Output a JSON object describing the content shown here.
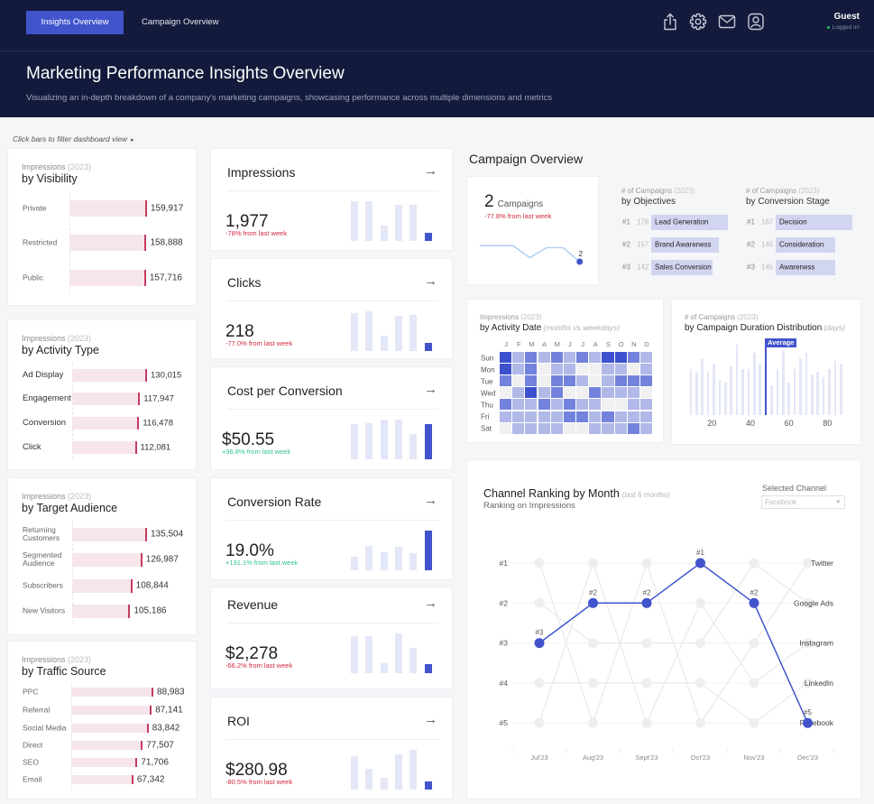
{
  "nav": {
    "tabs": [
      {
        "label": "Insights Overview",
        "active": true
      },
      {
        "label": "Campaign Overview",
        "active": false
      }
    ],
    "actions": [
      "share-icon",
      "gear-icon",
      "mail-icon",
      "user-icon"
    ],
    "user": {
      "name": "Guest",
      "status": "Logged in!"
    }
  },
  "header": {
    "title": "Marketing Performance Insights Overview",
    "subtitle": "Visualizing an in-depth breakdown of a company's marketing campaigns, showcasing performance across multiple dimensions and metrics"
  },
  "hint": "Click bars to filter dashboard view",
  "hint_caret": "▸",
  "colors": {
    "header_bg": "#131a3b",
    "accent": "#4154cc",
    "bar_light": "#e4e7f7",
    "breakdown_bar": "#f6e5ea",
    "breakdown_marker": "#c43c5f",
    "negative": "#d0283c",
    "positive": "#2fc38a",
    "rank_bar": "#d1d5f0",
    "sparkline": "#a9c8f0"
  },
  "breakdowns": [
    {
      "metric": "Impressions",
      "year": "(2023)",
      "title": "by Visibility",
      "rows": [
        {
          "label": "Private",
          "value": 159917,
          "display": "159,917"
        },
        {
          "label": "Restricted",
          "value": 158888,
          "display": "158,888"
        },
        {
          "label": "Public",
          "value": 157716,
          "display": "157,716"
        }
      ]
    },
    {
      "metric": "Impressions",
      "year": "(2023)",
      "title": "by Activity Type",
      "rows": [
        {
          "label": "Ad Display",
          "value": 130015,
          "display": "130,015"
        },
        {
          "label": "Engagement",
          "value": 117947,
          "display": "117,947"
        },
        {
          "label": "Conversion",
          "value": 116478,
          "display": "116,478"
        },
        {
          "label": "Click",
          "value": 112081,
          "display": "112,081"
        }
      ]
    },
    {
      "metric": "Impressions",
      "year": "(2023)",
      "title": "by Target Audience",
      "rows": [
        {
          "label": "Returning Customers",
          "value": 135504,
          "display": "135,504"
        },
        {
          "label": "Segmented Audience",
          "value": 126987,
          "display": "126,987"
        },
        {
          "label": "Subscribers",
          "value": 108844,
          "display": "108,844"
        },
        {
          "label": "New Visitors",
          "value": 105186,
          "display": "105,186"
        }
      ]
    },
    {
      "metric": "Impressions",
      "year": "(2023)",
      "title": "by Traffic Source",
      "rows": [
        {
          "label": "PPC",
          "value": 88983,
          "display": "88,983"
        },
        {
          "label": "Referral",
          "value": 87141,
          "display": "87,141"
        },
        {
          "label": "Social Media",
          "value": 83842,
          "display": "83,842"
        },
        {
          "label": "Direct",
          "value": 77507,
          "display": "77,507"
        },
        {
          "label": "SEO",
          "value": 71706,
          "display": "71,706"
        },
        {
          "label": "Email",
          "value": 67342,
          "display": "67,342"
        }
      ]
    }
  ],
  "kpis": [
    {
      "title": "Impressions",
      "value": "1,977",
      "change": "-78% from last week",
      "trend": "down",
      "arrow": "→",
      "weekly": [
        10000,
        10000,
        3800,
        9100,
        8990,
        1977
      ]
    },
    {
      "title": "Clicks",
      "value": "218",
      "change": "-77.0% from last week",
      "trend": "down",
      "arrow": "→",
      "weekly": [
        1000,
        1040,
        410,
        925,
        948,
        218
      ]
    },
    {
      "title": "Cost per Conversion",
      "value": "$50.55",
      "change": "+36.8% from last week",
      "trend": "up",
      "arrow": "→",
      "weekly": [
        50.55,
        52.3,
        57.6,
        57.6,
        36.95,
        50.55
      ]
    },
    {
      "title": "Conversion Rate",
      "value": "19.0%",
      "change": "+131.1% from last week",
      "trend": "up",
      "arrow": "→",
      "weekly": [
        6.4,
        11.7,
        8.6,
        11.3,
        8.2,
        19.0
      ]
    },
    {
      "title": "Revenue",
      "value": "$2,278",
      "change": "-66.2% from last week",
      "trend": "down",
      "arrow": "→",
      "weekly": [
        9790,
        9790,
        2650,
        10510,
        6740,
        2278
      ]
    },
    {
      "title": "ROI",
      "value": "$280.98",
      "change": "-80.5% from last week",
      "trend": "down",
      "arrow": "→",
      "weekly": [
        1223,
        764,
        426,
        1288,
        1441,
        280.98
      ]
    }
  ],
  "campaign_overview": {
    "section_title": "Campaign Overview",
    "summary": {
      "value": "2",
      "unit": "Campaigns",
      "change": "-77.8% from last week",
      "trend": "down",
      "sparkline": [
        10,
        10,
        10,
        4,
        9,
        9,
        2
      ],
      "last_label": "2"
    },
    "lists": [
      {
        "metric": "# of Campaigns",
        "year": "(2023)",
        "title": "by Objectives",
        "rows": [
          {
            "rank": "#1",
            "count": 178,
            "label": "Lead Generation"
          },
          {
            "rank": "#2",
            "count": 157,
            "label": "Brand Awareness"
          },
          {
            "rank": "#3",
            "count": 142,
            "label": "Sales Conversion"
          }
        ]
      },
      {
        "metric": "# of Campaigns",
        "year": "(2023)",
        "title": "by Conversion Stage",
        "rows": [
          {
            "rank": "#1",
            "count": 187,
            "label": "Decision"
          },
          {
            "rank": "#2",
            "count": 145,
            "label": "Consideration"
          },
          {
            "rank": "#3",
            "count": 145,
            "label": "Awareness"
          }
        ]
      }
    ]
  },
  "chart_data": [
    {
      "id": "activity-heatmap",
      "type": "heatmap",
      "metric": "Impressions",
      "year": "(2023)",
      "title": "by Activity Date",
      "subtitle": "(months vs weekdays)",
      "x": [
        "J",
        "F",
        "M",
        "A",
        "M",
        "J",
        "J",
        "A",
        "S",
        "O",
        "N",
        "D"
      ],
      "y": [
        "Sun",
        "Mon",
        "Tue",
        "Wed",
        "Thu",
        "Fri",
        "Sat"
      ],
      "scale": "intensity level 0 (none) to 3 (highest)",
      "palette": [
        "#f0f0f0",
        "#b1b9e8",
        "#7382dc",
        "#3d51cf"
      ],
      "values": [
        [
          3,
          1,
          2,
          1,
          2,
          1,
          2,
          1,
          3,
          3,
          2,
          1
        ],
        [
          3,
          1,
          2,
          0,
          1,
          1,
          0,
          0,
          1,
          1,
          0,
          1
        ],
        [
          2,
          0,
          2,
          0,
          2,
          2,
          1,
          0,
          1,
          2,
          2,
          2
        ],
        [
          0,
          1,
          3,
          1,
          2,
          0,
          0,
          2,
          1,
          1,
          1,
          0
        ],
        [
          2,
          1,
          1,
          2,
          1,
          2,
          1,
          1,
          0,
          0,
          1,
          1
        ],
        [
          1,
          1,
          1,
          1,
          1,
          2,
          2,
          1,
          2,
          1,
          1,
          1
        ],
        [
          0,
          1,
          1,
          1,
          1,
          0,
          0,
          1,
          1,
          1,
          2,
          1
        ]
      ]
    },
    {
      "id": "duration-histogram",
      "type": "bar",
      "metric": "# of Campaigns",
      "year": "(2023)",
      "title": "by Campaign Duration Distribution",
      "unit_label": "(days)",
      "x": [
        9,
        12,
        15,
        18,
        21,
        24,
        27,
        30,
        33,
        36,
        39,
        42,
        45,
        48,
        51,
        54,
        57,
        60,
        63,
        66,
        69,
        72,
        75,
        78,
        81,
        84,
        87
      ],
      "values": [
        17,
        16,
        21,
        16,
        19,
        13,
        12,
        18,
        26,
        17,
        17,
        23,
        19,
        17,
        11,
        17,
        24,
        12,
        17,
        21,
        23,
        15,
        16,
        14,
        17,
        20,
        19
      ],
      "xticks": [
        20,
        40,
        60,
        80
      ],
      "xlim": [
        5,
        90
      ],
      "average": 48,
      "average_label": "Average"
    },
    {
      "id": "channel-ranking",
      "type": "line",
      "title": "Channel Ranking by Month",
      "title_note": "(last 6 months)",
      "subtitle": "Ranking on Impressions",
      "categories": [
        "Jul'23",
        "Aug'23",
        "Sept'23",
        "Oct'23",
        "Nov'23",
        "Dec'23"
      ],
      "y_labels": [
        "#1",
        "#2",
        "#3",
        "#4",
        "#5"
      ],
      "series": [
        {
          "name": "Twitter",
          "values": [
            1,
            5,
            1,
            5,
            3,
            1
          ]
        },
        {
          "name": "Google Ads",
          "values": [
            2,
            3,
            3,
            3,
            1,
            2
          ]
        },
        {
          "name": "Instagram",
          "values": [
            5,
            1,
            5,
            2,
            4,
            3
          ]
        },
        {
          "name": "LinkedIn",
          "values": [
            4,
            4,
            4,
            4,
            5,
            4
          ]
        },
        {
          "name": "Facebook",
          "values": [
            3,
            2,
            2,
            1,
            2,
            5
          ]
        }
      ],
      "highlight": "Facebook",
      "selector": {
        "label": "Selected Channel",
        "value": "Facebook",
        "caret": "▾"
      }
    }
  ]
}
